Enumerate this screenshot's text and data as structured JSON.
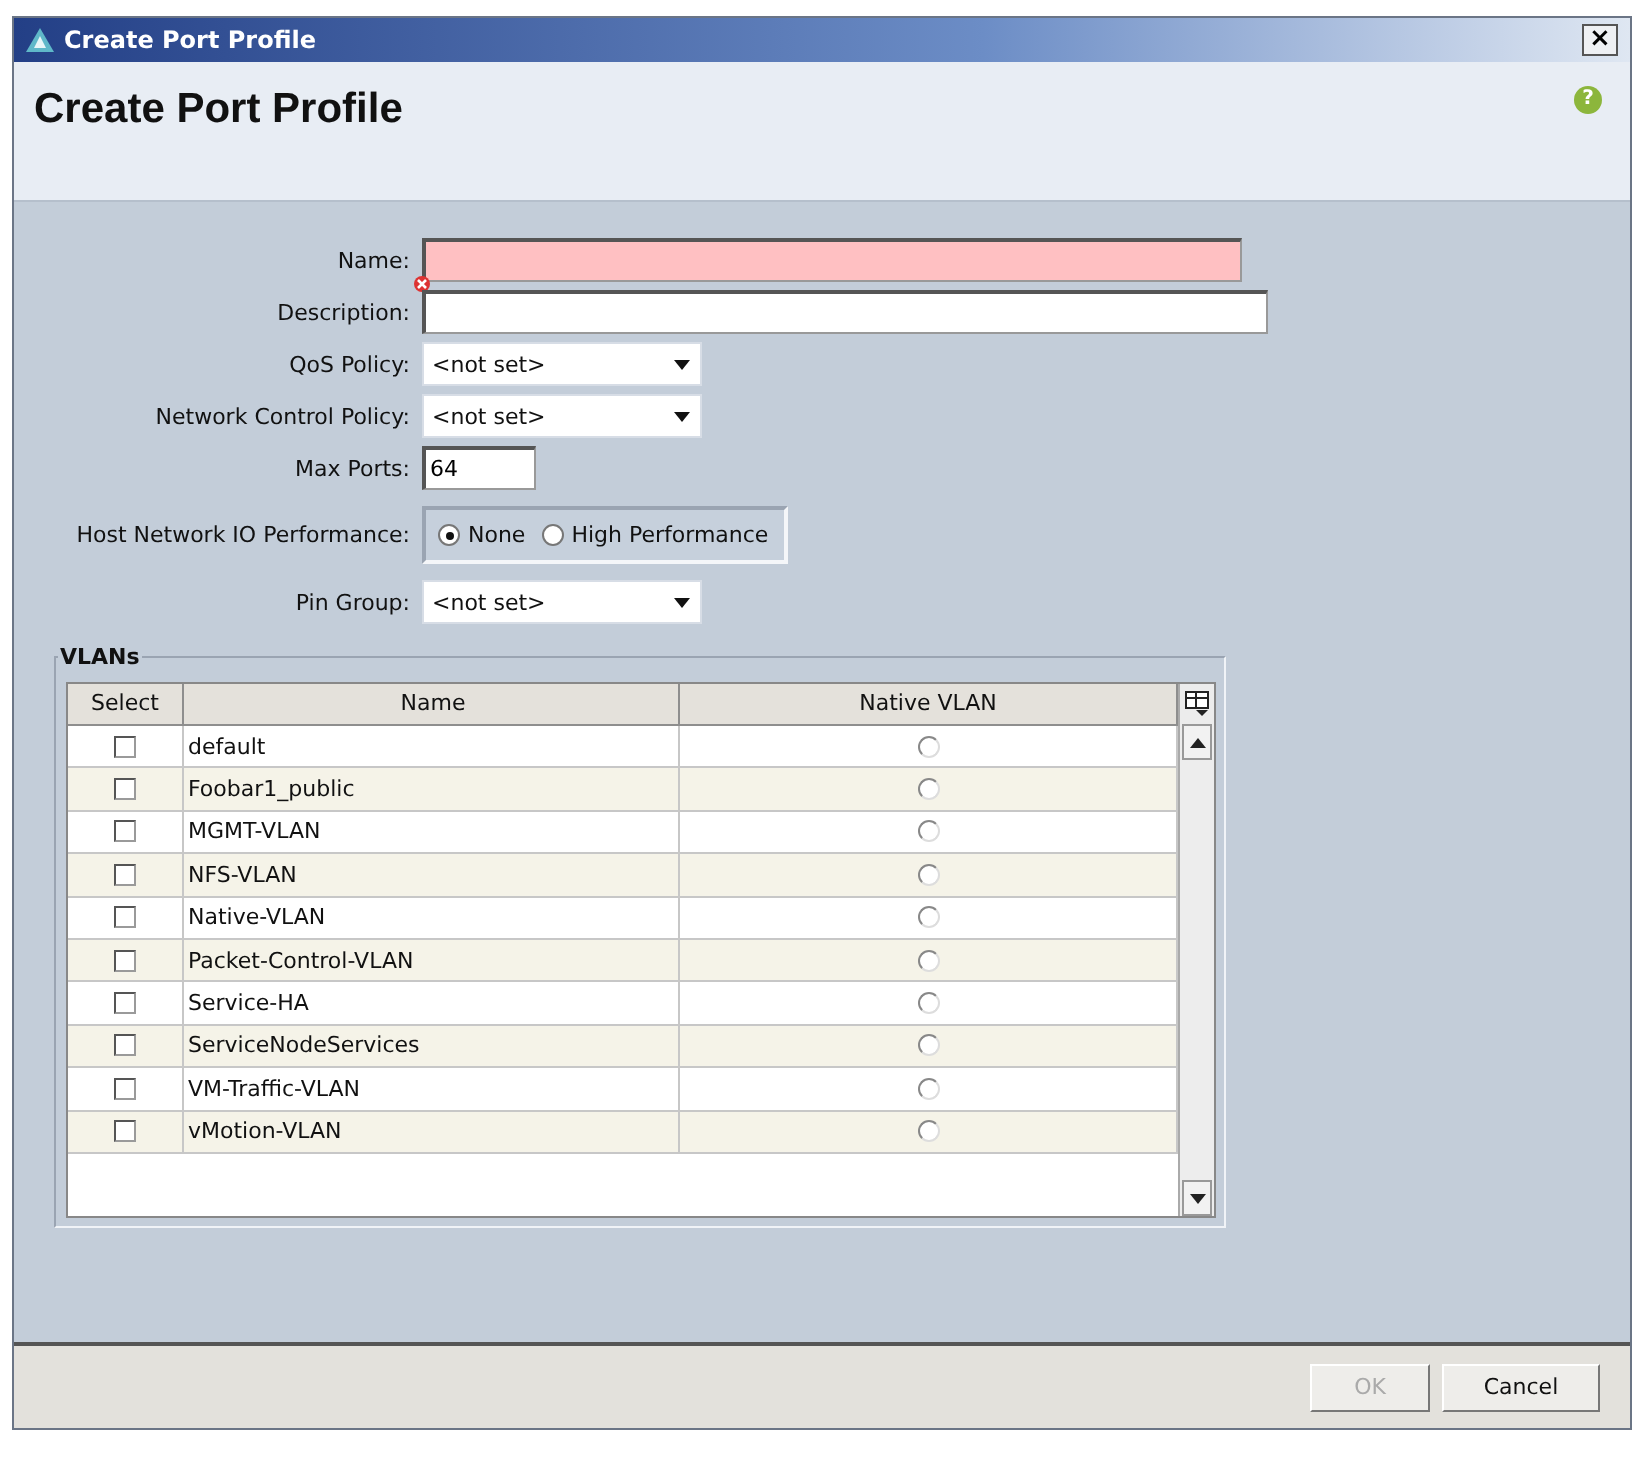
{
  "window": {
    "title": "Create Port Profile",
    "close": "×"
  },
  "header": {
    "title": "Create Port Profile",
    "help": "?"
  },
  "form": {
    "fields": [
      {
        "kind": "text",
        "label": "Name:",
        "error": true
      },
      {
        "kind": "text",
        "label": "Description:",
        "error": false
      },
      {
        "kind": "dropdown",
        "label": "QoS Policy:",
        "value": "<not set>"
      },
      {
        "kind": "dropdown",
        "label": "Network Control Policy:",
        "value": "<not set>"
      },
      {
        "kind": "text",
        "label": "Max Ports:",
        "value": "64",
        "error": false
      },
      {
        "kind": "radio",
        "label": "Host Network IO Performance:",
        "options": [
          {
            "label": "None",
            "selected": true
          },
          {
            "label": "High Performance",
            "selected": false
          }
        ]
      },
      {
        "kind": "dropdown",
        "label": "Pin Group:",
        "value": "<not set>"
      }
    ]
  },
  "vlans": {
    "title": "VLANs",
    "columns": [
      "Select",
      "Name",
      "Native VLAN"
    ],
    "rows": [
      {
        "name": "default",
        "checked": false,
        "native": false
      },
      {
        "name": "Foobar1_public",
        "checked": false,
        "native": false
      },
      {
        "name": "MGMT-VLAN",
        "checked": false,
        "native": false
      },
      {
        "name": "NFS-VLAN",
        "checked": false,
        "native": false
      },
      {
        "name": "Native-VLAN",
        "checked": false,
        "native": false
      },
      {
        "name": "Packet-Control-VLAN",
        "checked": false,
        "native": false
      },
      {
        "name": "Service-HA",
        "checked": false,
        "native": false
      },
      {
        "name": "ServiceNodeServices",
        "checked": false,
        "native": false
      },
      {
        "name": "VM-Traffic-VLAN",
        "checked": false,
        "native": false
      },
      {
        "name": "vMotion-VLAN",
        "checked": false,
        "native": false
      }
    ]
  },
  "buttons": [
    {
      "label": "OK",
      "disabled": true
    },
    {
      "label": "Cancel",
      "disabled": false
    }
  ]
}
